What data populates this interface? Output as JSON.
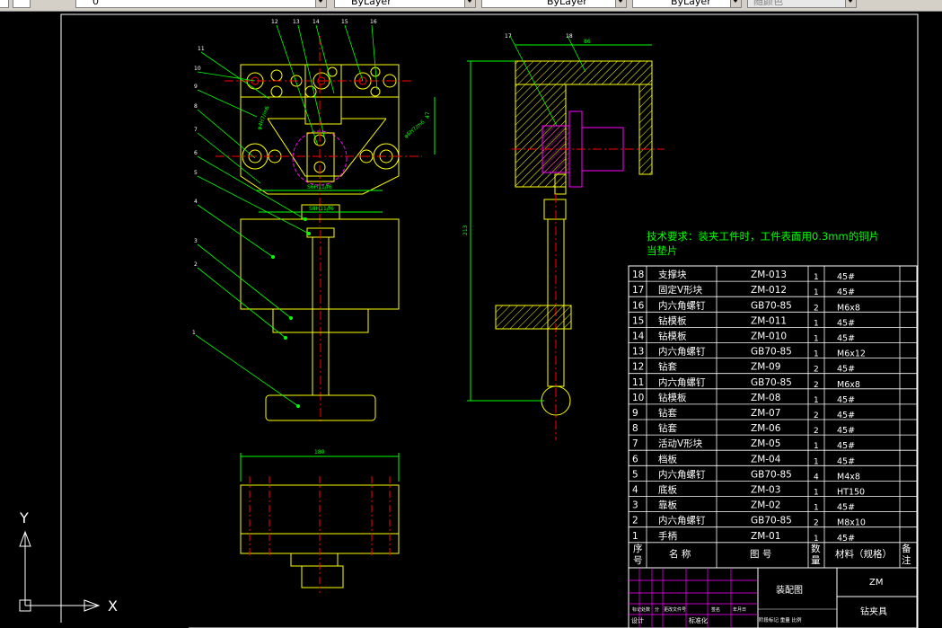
{
  "toolbar": {
    "layer_value": "0",
    "color_value": "ByLayer",
    "linetype_value": "ByLayer",
    "lineweight_value": "ByLayer",
    "plotstyle_value": "随颜色"
  },
  "ucs": {
    "x_label": "X",
    "y_label": "Y"
  },
  "drawing": {
    "tech_req_line1": "技术要求：装夹工件时，工件表面用0.3mm的铜片",
    "tech_req_line2": "当垫片",
    "dims": {
      "d1": "S6H11/f6",
      "d2": "S8H11/f6",
      "d3": "47",
      "d4": "86",
      "d5": "213",
      "d6": "180",
      "d7": "φ4H7/m6",
      "d8": "φ6H7/m6"
    },
    "balloons_front": [
      "1",
      "2",
      "3",
      "4",
      "5",
      "6",
      "7",
      "8",
      "9",
      "10",
      "11",
      "12",
      "13",
      "14",
      "15",
      "16"
    ],
    "balloons_side": [
      "17",
      "18"
    ]
  },
  "bom": {
    "rows": [
      {
        "no": "18",
        "name": "支撑块",
        "code": "ZM-013",
        "qty": "1",
        "mat": "45#"
      },
      {
        "no": "17",
        "name": "固定V形块",
        "code": "ZM-012",
        "qty": "1",
        "mat": "45#"
      },
      {
        "no": "16",
        "name": "内六角螺钉",
        "code": "GB70-85",
        "qty": "2",
        "mat": "M6x8"
      },
      {
        "no": "15",
        "name": "钻模板",
        "code": "ZM-011",
        "qty": "1",
        "mat": "45#"
      },
      {
        "no": "14",
        "name": "钻模板",
        "code": "ZM-010",
        "qty": "1",
        "mat": "45#"
      },
      {
        "no": "13",
        "name": "内六角螺钉",
        "code": "GB70-85",
        "qty": "1",
        "mat": "M6x12"
      },
      {
        "no": "12",
        "name": "钻套",
        "code": "ZM-09",
        "qty": "2",
        "mat": "45#"
      },
      {
        "no": "11",
        "name": "内六角螺钉",
        "code": "GB70-85",
        "qty": "2",
        "mat": "M6x8"
      },
      {
        "no": "10",
        "name": "钻模板",
        "code": "ZM-08",
        "qty": "1",
        "mat": "45#"
      },
      {
        "no": "9",
        "name": "钻套",
        "code": "ZM-07",
        "qty": "2",
        "mat": "45#"
      },
      {
        "no": "8",
        "name": "钻套",
        "code": "ZM-06",
        "qty": "2",
        "mat": "45#"
      },
      {
        "no": "7",
        "name": "活动V形块",
        "code": "ZM-05",
        "qty": "1",
        "mat": "45#"
      },
      {
        "no": "6",
        "name": "档板",
        "code": "ZM-04",
        "qty": "1",
        "mat": "45#"
      },
      {
        "no": "5",
        "name": "内六角螺钉",
        "code": "GB70-85",
        "qty": "4",
        "mat": "M4x8"
      },
      {
        "no": "4",
        "name": "底板",
        "code": "ZM-03",
        "qty": "1",
        "mat": "HT150"
      },
      {
        "no": "3",
        "name": "靠板",
        "code": "ZM-02",
        "qty": "1",
        "mat": "45#"
      },
      {
        "no": "2",
        "name": "内六角螺钉",
        "code": "GB70-85",
        "qty": "2",
        "mat": "M8x10"
      },
      {
        "no": "1",
        "name": "手柄",
        "code": "ZM-01",
        "qty": "1",
        "mat": "45#"
      }
    ],
    "header": {
      "no": "序号",
      "name": "名  称",
      "code": "图  号",
      "qty": "数量",
      "mat": "材料（规格）",
      "note": "备注"
    }
  },
  "title_block": {
    "assembly": "装配图",
    "company": "ZM",
    "drawing_name": "钻夹具",
    "revision_labels": [
      "标记",
      "处数",
      "分",
      "更改文件号",
      "签名",
      "年月日"
    ],
    "design_label": "设计",
    "std_label": "标准化",
    "stage_labels": "阶段标记 重量 比例"
  }
}
